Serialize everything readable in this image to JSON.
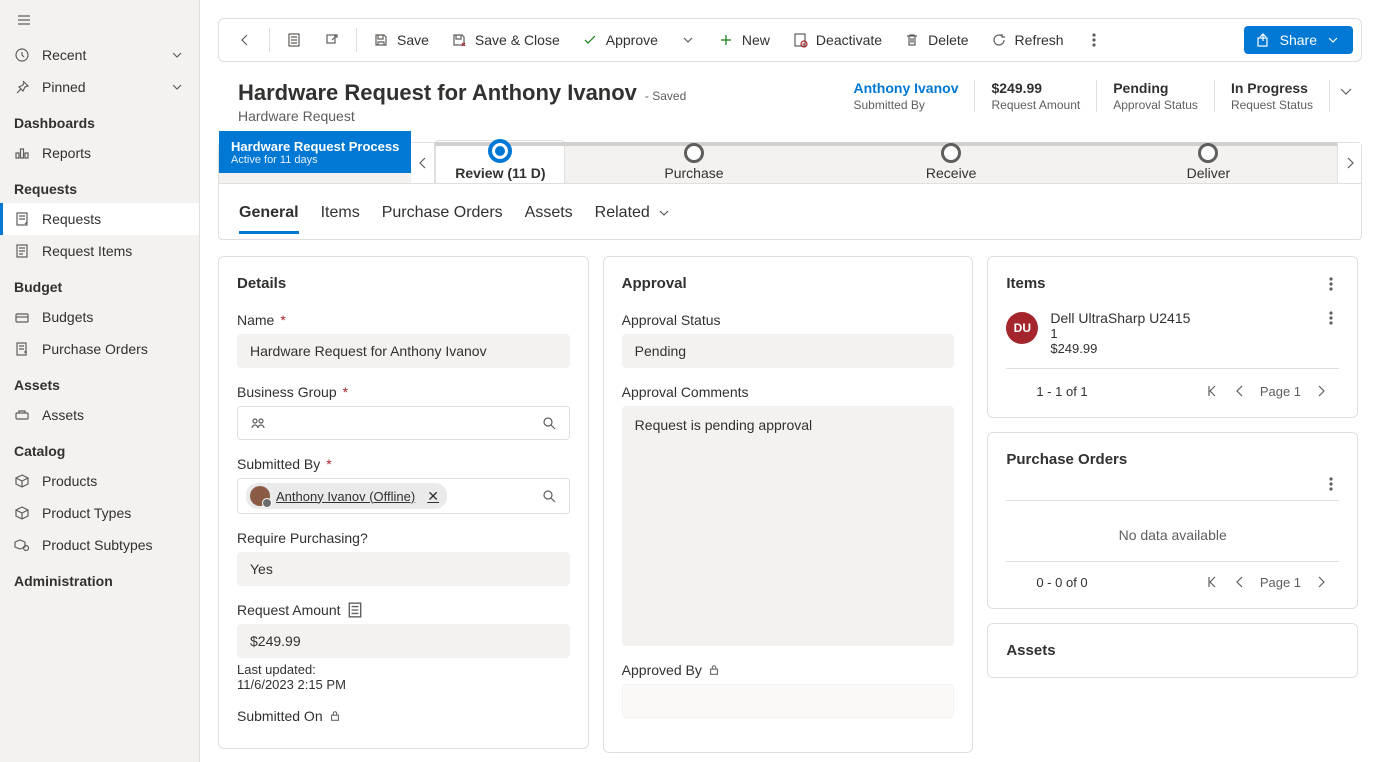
{
  "sidebar": {
    "top": {
      "recent": "Recent",
      "pinned": "Pinned"
    },
    "sections": [
      {
        "heading": "Dashboards",
        "items": [
          {
            "label": "Reports",
            "icon": "reports"
          }
        ]
      },
      {
        "heading": "Requests",
        "items": [
          {
            "label": "Requests",
            "icon": "requests",
            "active": true
          },
          {
            "label": "Request Items",
            "icon": "request-items"
          }
        ]
      },
      {
        "heading": "Budget",
        "items": [
          {
            "label": "Budgets",
            "icon": "budgets"
          },
          {
            "label": "Purchase Orders",
            "icon": "purchase-orders"
          }
        ]
      },
      {
        "heading": "Assets",
        "items": [
          {
            "label": "Assets",
            "icon": "assets"
          }
        ]
      },
      {
        "heading": "Catalog",
        "items": [
          {
            "label": "Products",
            "icon": "products"
          },
          {
            "label": "Product Types",
            "icon": "product-types"
          },
          {
            "label": "Product Subtypes",
            "icon": "product-subtypes"
          }
        ]
      },
      {
        "heading": "Administration",
        "items": []
      }
    ]
  },
  "commands": {
    "save": "Save",
    "saveClose": "Save & Close",
    "approve": "Approve",
    "new": "New",
    "deactivate": "Deactivate",
    "delete": "Delete",
    "refresh": "Refresh",
    "share": "Share"
  },
  "header": {
    "title": "Hardware Request for Anthony Ivanov",
    "savedLabel": "- Saved",
    "subtitle": "Hardware Request",
    "stats": [
      {
        "value": "Anthony Ivanov",
        "label": "Submitted By",
        "link": true
      },
      {
        "value": "$249.99",
        "label": "Request Amount"
      },
      {
        "value": "Pending",
        "label": "Approval Status"
      },
      {
        "value": "In Progress",
        "label": "Request Status"
      }
    ]
  },
  "process": {
    "name": "Hardware Request Process",
    "active": "Active for 11 days",
    "stages": [
      {
        "label": "Review  (11 D)",
        "active": true
      },
      {
        "label": "Purchase"
      },
      {
        "label": "Receive"
      },
      {
        "label": "Deliver"
      }
    ]
  },
  "tabs": [
    "General",
    "Items",
    "Purchase Orders",
    "Assets",
    "Related"
  ],
  "details": {
    "heading": "Details",
    "nameLabel": "Name",
    "nameValue": "Hardware Request for Anthony Ivanov",
    "bizGroupLabel": "Business Group",
    "submittedByLabel": "Submitted By",
    "submittedByValue": "Anthony Ivanov (Offline)",
    "requirePurchasingLabel": "Require Purchasing?",
    "requirePurchasingValue": "Yes",
    "requestAmountLabel": "Request Amount",
    "requestAmountValue": "$249.99",
    "lastUpdatedLabel": "Last updated:",
    "lastUpdatedValue": "11/6/2023 2:15 PM",
    "submittedOnLabel": "Submitted On"
  },
  "approval": {
    "heading": "Approval",
    "statusLabel": "Approval Status",
    "statusValue": "Pending",
    "commentsLabel": "Approval Comments",
    "commentsValue": "Request is pending approval",
    "approvedByLabel": "Approved By"
  },
  "sidePanels": {
    "items": {
      "title": "Items",
      "row": {
        "badge": "DU",
        "title": "Dell UltraSharp U2415",
        "line2": "1",
        "line3": "$249.99"
      },
      "pager": "1 - 1 of 1",
      "page": "Page 1"
    },
    "purchaseOrders": {
      "title": "Purchase Orders",
      "empty": "No data available",
      "pager": "0 - 0 of 0",
      "page": "Page 1"
    },
    "assets": {
      "title": "Assets"
    }
  }
}
